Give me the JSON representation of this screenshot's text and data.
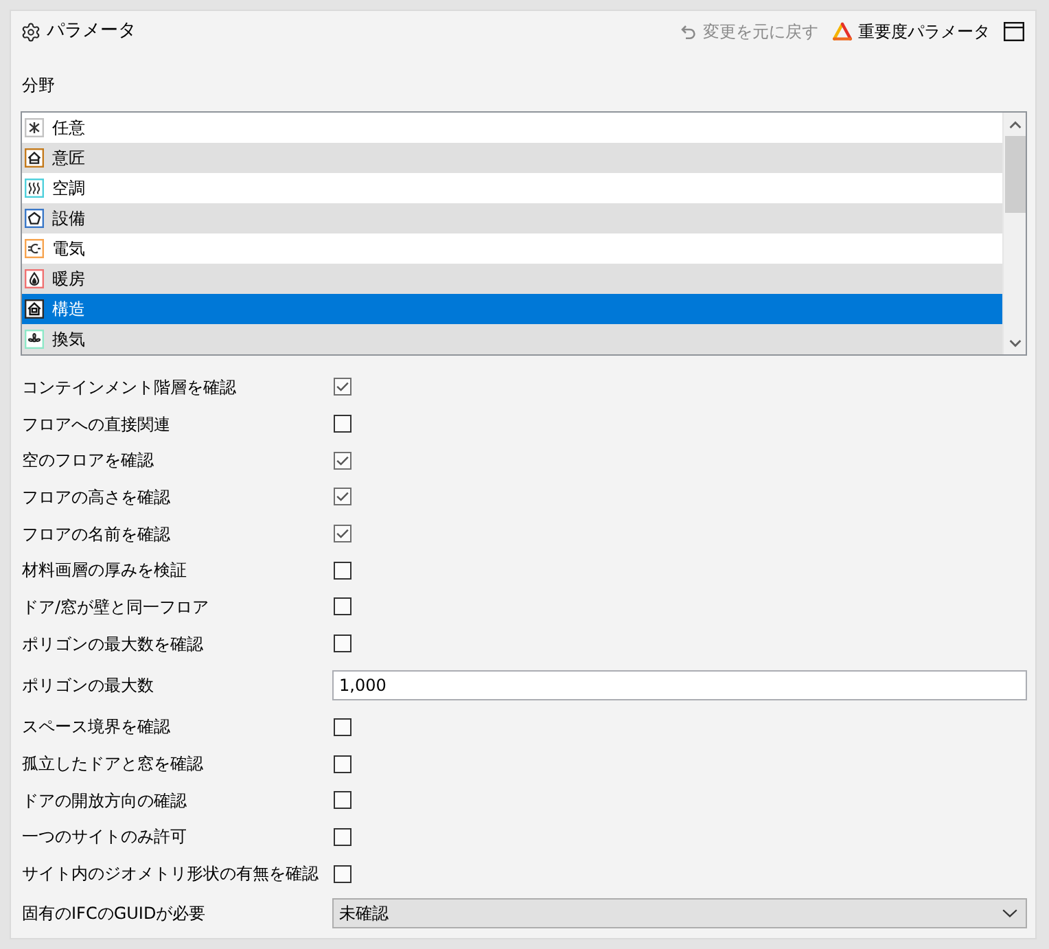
{
  "panel": {
    "title": "パラメータ",
    "actions": [
      {
        "kind": "undo",
        "label": "変更を元に戻す",
        "disabled": true
      },
      {
        "kind": "severity",
        "label": "重要度パラメータ",
        "disabled": false
      }
    ]
  },
  "field_list": {
    "label": "分野",
    "items": [
      {
        "kind": "asterisk",
        "label": "任意",
        "color": "#c3c3c3",
        "selected": false
      },
      {
        "kind": "house",
        "label": "意匠",
        "color": "#c47a1c",
        "selected": false
      },
      {
        "kind": "waves",
        "label": "空調",
        "color": "#4fd0dc",
        "selected": false
      },
      {
        "kind": "pentagon",
        "label": "設備",
        "color": "#3a78c8",
        "selected": false
      },
      {
        "kind": "plug",
        "label": "電気",
        "color": "#f7a44f",
        "selected": false
      },
      {
        "kind": "flame",
        "label": "暖房",
        "color": "#f07272",
        "selected": false
      },
      {
        "kind": "building",
        "label": "構造",
        "color": "#2a2a2a",
        "selected": true
      },
      {
        "kind": "fan",
        "label": "換気",
        "color": "#8ee8c8",
        "selected": false
      }
    ]
  },
  "parameters": [
    {
      "kind": "checkbox",
      "label": "コンテインメント階層を確認",
      "checked": true
    },
    {
      "kind": "checkbox",
      "label": "フロアへの直接関連",
      "checked": false
    },
    {
      "kind": "checkbox",
      "label": "空のフロアを確認",
      "checked": true
    },
    {
      "kind": "checkbox",
      "label": "フロアの高さを確認",
      "checked": true
    },
    {
      "kind": "checkbox",
      "label": "フロアの名前を確認",
      "checked": true
    },
    {
      "kind": "checkbox",
      "label": "材料画層の厚みを検証",
      "checked": false
    },
    {
      "kind": "checkbox",
      "label": "ドア/窓が壁と同一フロア",
      "checked": false
    },
    {
      "kind": "checkbox",
      "label": "ポリゴンの最大数を確認",
      "checked": false
    },
    {
      "kind": "text",
      "label": "ポリゴンの最大数",
      "value": "1,000"
    },
    {
      "kind": "checkbox",
      "label": "スペース境界を確認",
      "checked": false
    },
    {
      "kind": "checkbox",
      "label": "孤立したドアと窓を確認",
      "checked": false
    },
    {
      "kind": "checkbox",
      "label": "ドアの開放方向の確認",
      "checked": false
    },
    {
      "kind": "checkbox",
      "label": "一つのサイトのみ許可",
      "checked": false
    },
    {
      "kind": "checkbox",
      "label": "サイト内のジオメトリ形状の有無を確認",
      "checked": false
    },
    {
      "kind": "dropdown",
      "label": "固有のIFCのGUIDが必要",
      "value": "未確認"
    }
  ]
}
